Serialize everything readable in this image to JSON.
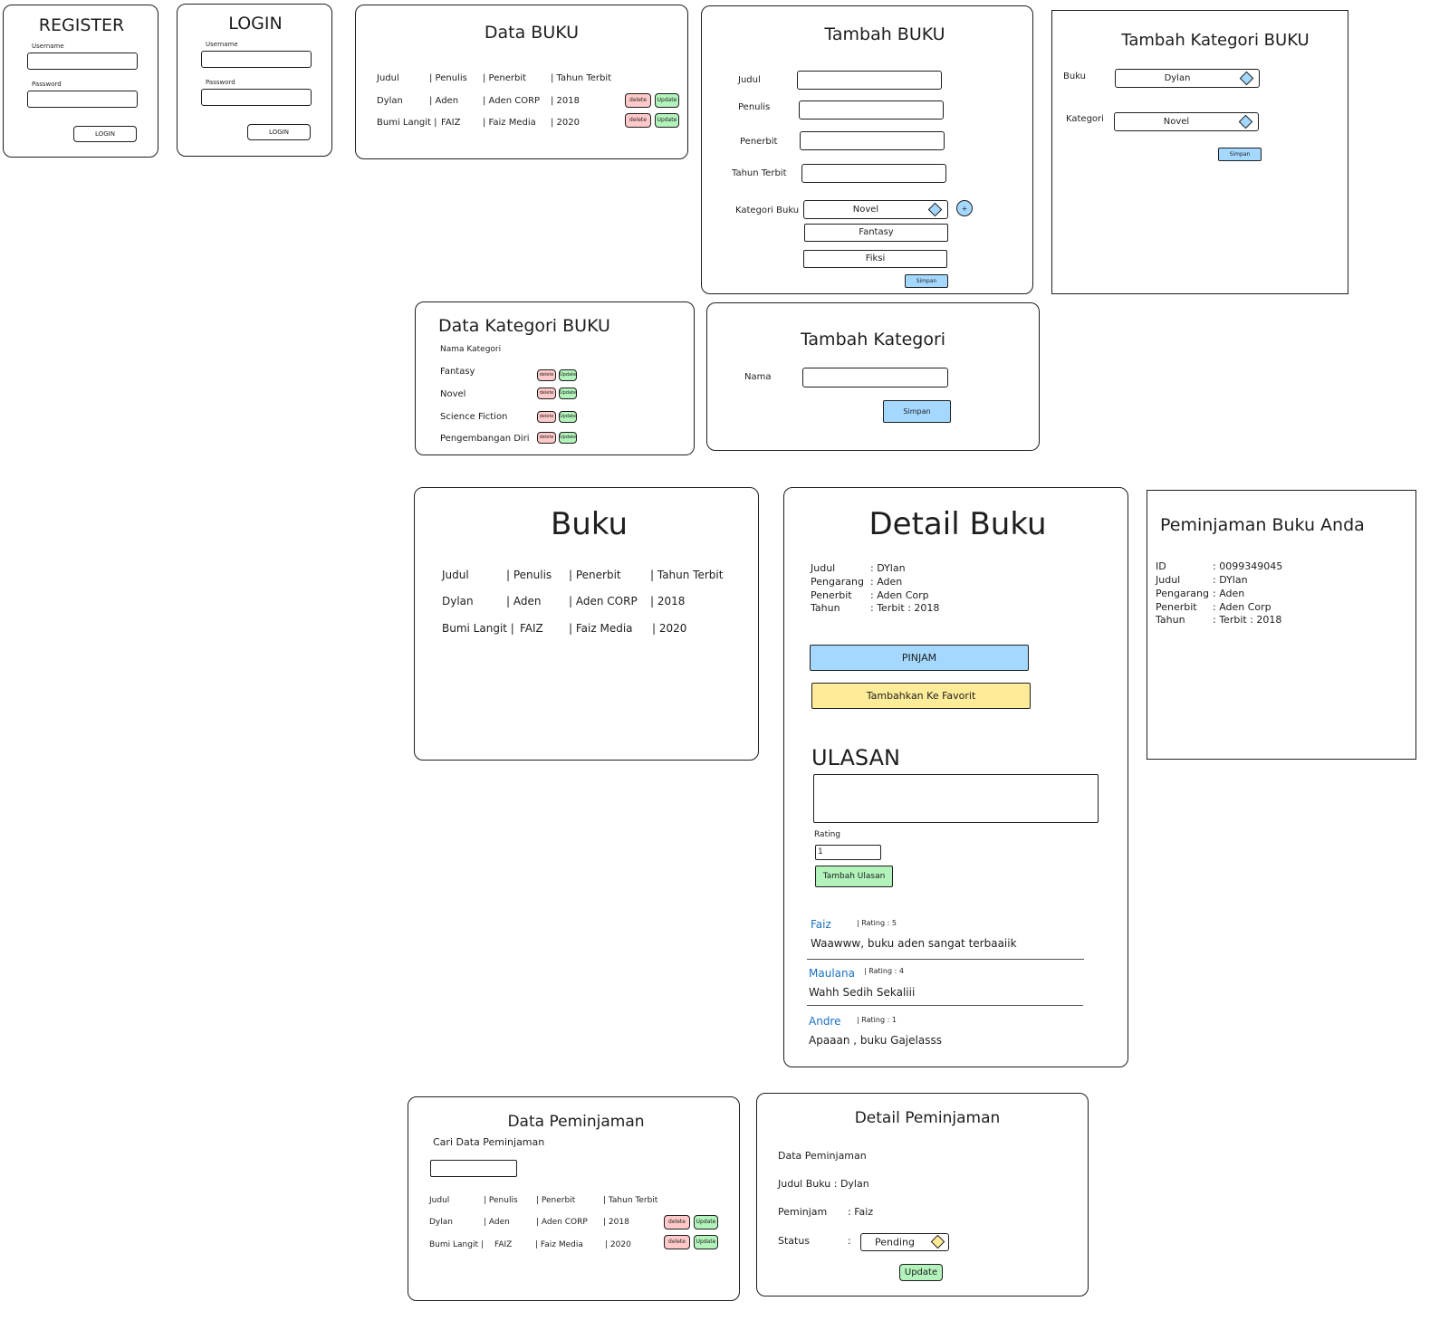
{
  "register": {
    "title": "REGISTER",
    "username_label": "Username",
    "password_label": "Password",
    "button": "LOGIN"
  },
  "login": {
    "title": "LOGIN",
    "username_label": "Username",
    "password_label": "Password",
    "button": "LOGIN"
  },
  "data_buku": {
    "title": "Data BUKU",
    "headers": [
      "Judul",
      "| Penulis",
      "| Penerbit",
      "| Tahun Terbit"
    ],
    "rows": [
      [
        "Dylan",
        "| Aden",
        "| Aden CORP",
        "| 2018"
      ],
      [
        "Bumi Langit |",
        "FAIZ",
        "| Faiz Media",
        "| 2020"
      ]
    ],
    "delete_label": "delete",
    "update_label": "Update"
  },
  "tambah_buku": {
    "title": "Tambah BUKU",
    "fields": [
      "Judul",
      "Penulis",
      "Penerbit",
      "Tahun Terbit"
    ],
    "kategori_label": "Kategori Buku",
    "kategori_selected": "Novel",
    "kategori_options": [
      "Fantasy",
      "Fiksi"
    ],
    "add_symbol": "+",
    "save_label": "Simpan"
  },
  "tambah_kategori_buku": {
    "title": "Tambah Kategori BUKU",
    "buku_label": "Buku",
    "buku_value": "Dylan",
    "kategori_label": "Kategori",
    "kategori_value": "Novel",
    "save_label": "Simpan"
  },
  "data_kategori": {
    "title": "Data Kategori BUKU",
    "header": "Nama Kategori",
    "items": [
      "Fantasy",
      "Novel",
      "Science Fiction",
      "Pengembangan Diri"
    ],
    "delete_label": "delete",
    "update_label": "Update"
  },
  "tambah_kategori": {
    "title": "Tambah Kategori",
    "nama_label": "Nama",
    "save_label": "Simpan"
  },
  "buku": {
    "title": "Buku",
    "headers": [
      "Judul",
      "| Penulis",
      "| Penerbit",
      "| Tahun Terbit"
    ],
    "rows": [
      [
        "Dylan",
        "| Aden",
        "| Aden CORP",
        "| 2018"
      ],
      [
        "Bumi Langit |",
        "FAIZ",
        "| Faiz Media",
        "| 2020"
      ]
    ]
  },
  "detail_buku": {
    "title": "Detail Buku",
    "info": [
      [
        "Judul",
        ": DYlan"
      ],
      [
        "Pengarang",
        ": Aden"
      ],
      [
        "Penerbit",
        ": Aden Corp"
      ],
      [
        "Tahun",
        ": Terbit : 2018"
      ]
    ],
    "pinjam_label": "PINJAM",
    "favorit_label": "Tambahkan Ke Favorit",
    "ulasan_title": "ULASAN",
    "rating_label": "Rating",
    "rating_value": "1",
    "tambah_ulasan_label": "Tambah Ulasan",
    "reviews": [
      {
        "name": "Faiz",
        "rating": "| Rating : 5",
        "text": "Waawww, buku aden sangat terbaaiik"
      },
      {
        "name": "Maulana",
        "rating": "| Rating : 4",
        "text": "Wahh Sedih Sekaliii"
      },
      {
        "name": "Andre",
        "rating": "| Rating : 1",
        "text": "Apaaan , buku Gajelasss"
      }
    ]
  },
  "peminjaman_anda": {
    "title": "Peminjaman Buku Anda",
    "info": [
      [
        "ID",
        ": 0099349045"
      ],
      [
        "Judul",
        ": DYlan"
      ],
      [
        "Pengarang",
        ": Aden"
      ],
      [
        "Penerbit",
        ": Aden Corp"
      ],
      [
        "Tahun",
        ": Terbit : 2018"
      ]
    ]
  },
  "data_peminjaman": {
    "title": "Data Peminjaman",
    "search_label": "Cari Data Peminjaman",
    "headers": [
      "Judul",
      "| Penulis",
      "| Penerbit",
      "| Tahun Terbit"
    ],
    "rows": [
      [
        "Dylan",
        "| Aden",
        "| Aden CORP",
        "| 2018"
      ],
      [
        "Bumi Langit |",
        "FAIZ",
        "| Faiz Media",
        "| 2020"
      ]
    ],
    "delete_label": "delete",
    "update_label": "Update"
  },
  "detail_peminjaman": {
    "title": "Detail Peminjaman",
    "section": "Data Peminjaman",
    "judul_label": "Judul Buku : Dylan",
    "peminjam_label": "Peminjam",
    "peminjam_value": ": Faiz",
    "status_label": "Status",
    "status_colon": ":",
    "status_value": "Pending",
    "update_label": "Update"
  },
  "colors": {
    "delete": "#ffc9c9",
    "update": "#b2f2bb",
    "primary": "#a5d8ff",
    "favorite": "#ffec99",
    "status_diamond": "#ffec99",
    "reviewer_name": "#1971c2"
  }
}
